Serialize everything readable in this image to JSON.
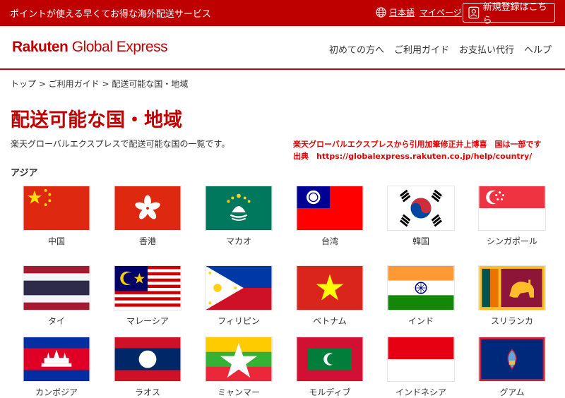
{
  "topbar": {
    "tagline": "ポイントが使える早くてお得な海外配送サービス",
    "language": "日本語",
    "mypage": "マイページ",
    "register": "新規登録はこちら"
  },
  "header": {
    "logo_rakuten": "Rakuten",
    "logo_product": "Global Express",
    "nav": [
      "初めての方へ",
      "ご利用ガイド",
      "お支払い代行",
      "ヘルプ"
    ]
  },
  "breadcrumb": "トップ > ご利用ガイド > 配送可能な国・地域",
  "page_title": "配送可能な国・地域",
  "description": "楽天グローバルエクスプレスで配送可能な国の一覧です。",
  "note_line1": "楽天グローバルエクスプレスから引用加筆修正井上博喜　国は一部です",
  "note_line2": "出典　https://globalexpress.rakuten.co.jp/help/country/",
  "region": "アジア",
  "countries": [
    {
      "name": "中国",
      "flag": "china-flag-icon"
    },
    {
      "name": "香港",
      "flag": "hong-kong-flag-icon"
    },
    {
      "name": "マカオ",
      "flag": "macao-flag-icon"
    },
    {
      "name": "台湾",
      "flag": "taiwan-flag-icon"
    },
    {
      "name": "韓国",
      "flag": "korea-flag-icon"
    },
    {
      "name": "シンガポール",
      "flag": "singapore-flag-icon"
    },
    {
      "name": "タイ",
      "flag": "thailand-flag-icon"
    },
    {
      "name": "マレーシア",
      "flag": "malaysia-flag-icon"
    },
    {
      "name": "フィリピン",
      "flag": "philippines-flag-icon"
    },
    {
      "name": "ベトナム",
      "flag": "vietnam-flag-icon"
    },
    {
      "name": "インド",
      "flag": "india-flag-icon"
    },
    {
      "name": "スリランカ",
      "flag": "sri-lanka-flag-icon"
    },
    {
      "name": "カンボジア",
      "flag": "cambodia-flag-icon"
    },
    {
      "name": "ラオス",
      "flag": "laos-flag-icon"
    },
    {
      "name": "ミャンマー",
      "flag": "myanmar-flag-icon"
    },
    {
      "name": "モルディブ",
      "flag": "maldives-flag-icon"
    },
    {
      "name": "インドネシア",
      "flag": "indonesia-flag-icon"
    },
    {
      "name": "グアム",
      "flag": "guam-flag-icon"
    }
  ],
  "colors": {
    "brand": "#bf0000",
    "note": "#e00000"
  }
}
